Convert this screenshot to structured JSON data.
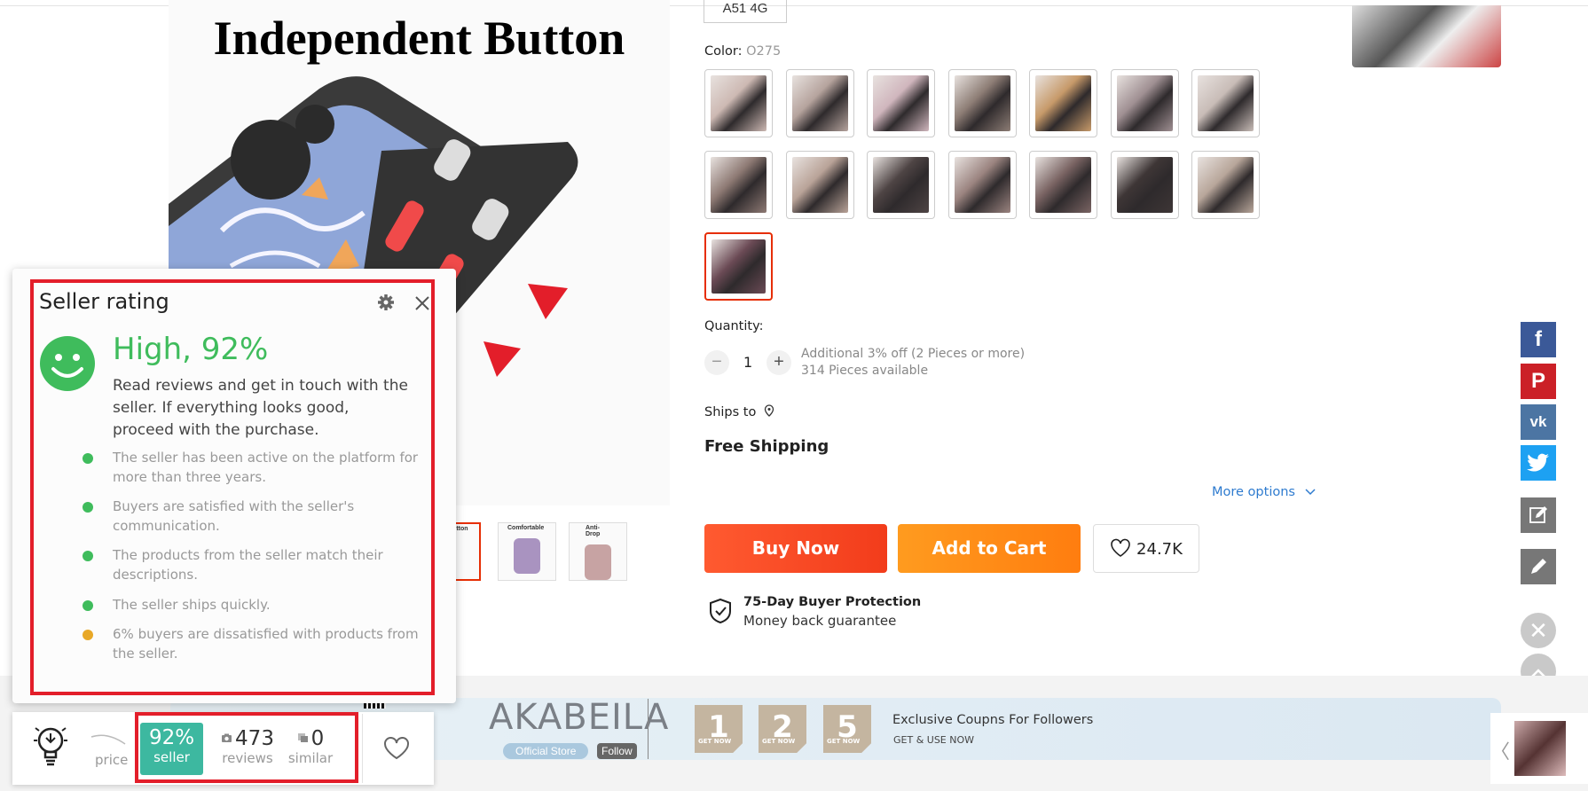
{
  "product": {
    "image_title": "Independent Button",
    "variant_chip": "A51 4G",
    "color_label": "Color:",
    "color_value": "O275",
    "quantity_label": "Quantity:",
    "quantity_value": "1",
    "discount_note": "Additional 3% off (2 Pieces or more)",
    "stock_note": "314 Pieces available",
    "ships_to_label": "Ships to",
    "shipping": "Free Shipping",
    "more_options": "More options",
    "buy_now": "Buy Now",
    "add_to_cart": "Add to Cart",
    "wishlist_count": "24.7K",
    "protection_title": "75-Day Buyer Protection",
    "protection_sub": "Money back guarantee",
    "thumbnail_labels": [
      "ndent Button",
      "Comfortable",
      "Anti-Drop"
    ]
  },
  "store": {
    "name": "AKABEILA",
    "badge": "Official Store",
    "follow": "Follow",
    "coupons": [
      "1",
      "2",
      "5"
    ],
    "coupon_tag": "GET NOW",
    "coupon_title": "Exclusive Coupns For Followers",
    "coupon_sub": "GET & USE NOW"
  },
  "seller_rating": {
    "title": "Seller rating",
    "level": "High, 92%",
    "summary": "Read reviews and get in touch with the seller. If everything looks good, proceed with the purchase.",
    "reasons": [
      {
        "text": "The seller has been active on the platform for more than three years.",
        "status": "good"
      },
      {
        "text": "Buyers are satisfied with the seller's communication.",
        "status": "good"
      },
      {
        "text": "The products from the seller match their descriptions.",
        "status": "good"
      },
      {
        "text": "The seller ships quickly.",
        "status": "good"
      },
      {
        "text": "6% buyers are dissatisfied with products from the seller.",
        "status": "warn"
      }
    ]
  },
  "toolbar": {
    "price_label": "price",
    "seller_value": "92%",
    "seller_label": "seller",
    "reviews_value": "473",
    "reviews_label": "reviews",
    "similar_value": "0",
    "similar_label": "similar"
  },
  "colors": {
    "accent_red": "#e31e2a",
    "rating_green": "#3fbc5c",
    "warn_orange": "#e8a827",
    "buy_red": "#f23c1b",
    "cart_orange": "#ff8c16",
    "seller_teal": "#3db8a0",
    "link_blue": "#2e7bcf"
  },
  "icons": [
    "heart-icon",
    "gear-icon",
    "close-icon",
    "smiley-icon",
    "location-pin-icon",
    "shield-check-icon",
    "lightbulb-icon",
    "camera-icon",
    "stack-icon",
    "facebook-icon",
    "pinterest-icon",
    "vk-icon",
    "twitter-icon",
    "edit-icon",
    "pencil-icon",
    "close-circle-icon",
    "scroll-up-icon",
    "chevron-down-icon"
  ]
}
